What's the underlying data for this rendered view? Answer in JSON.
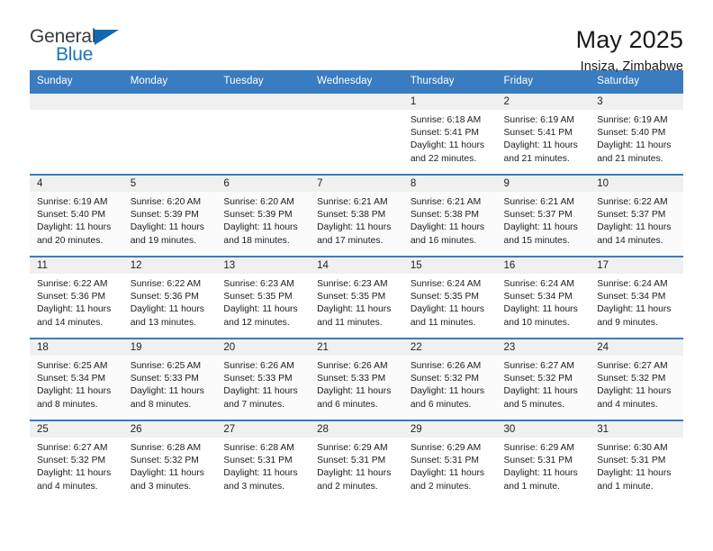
{
  "brand": {
    "name_top": "General",
    "name_bottom": "Blue",
    "accent_color": "#1b75bb",
    "triangle_color": "#1268b3"
  },
  "header": {
    "title": "May 2025",
    "location": "Insiza, Zimbabwe"
  },
  "calendar": {
    "header_background": "#3a7cc0",
    "header_text_color": "#ffffff",
    "daynum_background": "#f0f0f0",
    "weekday_headers": [
      "Sunday",
      "Monday",
      "Tuesday",
      "Wednesday",
      "Thursday",
      "Friday",
      "Saturday"
    ],
    "weeks": [
      [
        {
          "day": "",
          "sunrise": "",
          "sunset": "",
          "daylight_line1": "",
          "daylight_line2": ""
        },
        {
          "day": "",
          "sunrise": "",
          "sunset": "",
          "daylight_line1": "",
          "daylight_line2": ""
        },
        {
          "day": "",
          "sunrise": "",
          "sunset": "",
          "daylight_line1": "",
          "daylight_line2": ""
        },
        {
          "day": "",
          "sunrise": "",
          "sunset": "",
          "daylight_line1": "",
          "daylight_line2": ""
        },
        {
          "day": "1",
          "sunrise": "Sunrise: 6:18 AM",
          "sunset": "Sunset: 5:41 PM",
          "daylight_line1": "Daylight: 11 hours",
          "daylight_line2": "and 22 minutes."
        },
        {
          "day": "2",
          "sunrise": "Sunrise: 6:19 AM",
          "sunset": "Sunset: 5:41 PM",
          "daylight_line1": "Daylight: 11 hours",
          "daylight_line2": "and 21 minutes."
        },
        {
          "day": "3",
          "sunrise": "Sunrise: 6:19 AM",
          "sunset": "Sunset: 5:40 PM",
          "daylight_line1": "Daylight: 11 hours",
          "daylight_line2": "and 21 minutes."
        }
      ],
      [
        {
          "day": "4",
          "sunrise": "Sunrise: 6:19 AM",
          "sunset": "Sunset: 5:40 PM",
          "daylight_line1": "Daylight: 11 hours",
          "daylight_line2": "and 20 minutes."
        },
        {
          "day": "5",
          "sunrise": "Sunrise: 6:20 AM",
          "sunset": "Sunset: 5:39 PM",
          "daylight_line1": "Daylight: 11 hours",
          "daylight_line2": "and 19 minutes."
        },
        {
          "day": "6",
          "sunrise": "Sunrise: 6:20 AM",
          "sunset": "Sunset: 5:39 PM",
          "daylight_line1": "Daylight: 11 hours",
          "daylight_line2": "and 18 minutes."
        },
        {
          "day": "7",
          "sunrise": "Sunrise: 6:21 AM",
          "sunset": "Sunset: 5:38 PM",
          "daylight_line1": "Daylight: 11 hours",
          "daylight_line2": "and 17 minutes."
        },
        {
          "day": "8",
          "sunrise": "Sunrise: 6:21 AM",
          "sunset": "Sunset: 5:38 PM",
          "daylight_line1": "Daylight: 11 hours",
          "daylight_line2": "and 16 minutes."
        },
        {
          "day": "9",
          "sunrise": "Sunrise: 6:21 AM",
          "sunset": "Sunset: 5:37 PM",
          "daylight_line1": "Daylight: 11 hours",
          "daylight_line2": "and 15 minutes."
        },
        {
          "day": "10",
          "sunrise": "Sunrise: 6:22 AM",
          "sunset": "Sunset: 5:37 PM",
          "daylight_line1": "Daylight: 11 hours",
          "daylight_line2": "and 14 minutes."
        }
      ],
      [
        {
          "day": "11",
          "sunrise": "Sunrise: 6:22 AM",
          "sunset": "Sunset: 5:36 PM",
          "daylight_line1": "Daylight: 11 hours",
          "daylight_line2": "and 14 minutes."
        },
        {
          "day": "12",
          "sunrise": "Sunrise: 6:22 AM",
          "sunset": "Sunset: 5:36 PM",
          "daylight_line1": "Daylight: 11 hours",
          "daylight_line2": "and 13 minutes."
        },
        {
          "day": "13",
          "sunrise": "Sunrise: 6:23 AM",
          "sunset": "Sunset: 5:35 PM",
          "daylight_line1": "Daylight: 11 hours",
          "daylight_line2": "and 12 minutes."
        },
        {
          "day": "14",
          "sunrise": "Sunrise: 6:23 AM",
          "sunset": "Sunset: 5:35 PM",
          "daylight_line1": "Daylight: 11 hours",
          "daylight_line2": "and 11 minutes."
        },
        {
          "day": "15",
          "sunrise": "Sunrise: 6:24 AM",
          "sunset": "Sunset: 5:35 PM",
          "daylight_line1": "Daylight: 11 hours",
          "daylight_line2": "and 11 minutes."
        },
        {
          "day": "16",
          "sunrise": "Sunrise: 6:24 AM",
          "sunset": "Sunset: 5:34 PM",
          "daylight_line1": "Daylight: 11 hours",
          "daylight_line2": "and 10 minutes."
        },
        {
          "day": "17",
          "sunrise": "Sunrise: 6:24 AM",
          "sunset": "Sunset: 5:34 PM",
          "daylight_line1": "Daylight: 11 hours",
          "daylight_line2": "and 9 minutes."
        }
      ],
      [
        {
          "day": "18",
          "sunrise": "Sunrise: 6:25 AM",
          "sunset": "Sunset: 5:34 PM",
          "daylight_line1": "Daylight: 11 hours",
          "daylight_line2": "and 8 minutes."
        },
        {
          "day": "19",
          "sunrise": "Sunrise: 6:25 AM",
          "sunset": "Sunset: 5:33 PM",
          "daylight_line1": "Daylight: 11 hours",
          "daylight_line2": "and 8 minutes."
        },
        {
          "day": "20",
          "sunrise": "Sunrise: 6:26 AM",
          "sunset": "Sunset: 5:33 PM",
          "daylight_line1": "Daylight: 11 hours",
          "daylight_line2": "and 7 minutes."
        },
        {
          "day": "21",
          "sunrise": "Sunrise: 6:26 AM",
          "sunset": "Sunset: 5:33 PM",
          "daylight_line1": "Daylight: 11 hours",
          "daylight_line2": "and 6 minutes."
        },
        {
          "day": "22",
          "sunrise": "Sunrise: 6:26 AM",
          "sunset": "Sunset: 5:32 PM",
          "daylight_line1": "Daylight: 11 hours",
          "daylight_line2": "and 6 minutes."
        },
        {
          "day": "23",
          "sunrise": "Sunrise: 6:27 AM",
          "sunset": "Sunset: 5:32 PM",
          "daylight_line1": "Daylight: 11 hours",
          "daylight_line2": "and 5 minutes."
        },
        {
          "day": "24",
          "sunrise": "Sunrise: 6:27 AM",
          "sunset": "Sunset: 5:32 PM",
          "daylight_line1": "Daylight: 11 hours",
          "daylight_line2": "and 4 minutes."
        }
      ],
      [
        {
          "day": "25",
          "sunrise": "Sunrise: 6:27 AM",
          "sunset": "Sunset: 5:32 PM",
          "daylight_line1": "Daylight: 11 hours",
          "daylight_line2": "and 4 minutes."
        },
        {
          "day": "26",
          "sunrise": "Sunrise: 6:28 AM",
          "sunset": "Sunset: 5:32 PM",
          "daylight_line1": "Daylight: 11 hours",
          "daylight_line2": "and 3 minutes."
        },
        {
          "day": "27",
          "sunrise": "Sunrise: 6:28 AM",
          "sunset": "Sunset: 5:31 PM",
          "daylight_line1": "Daylight: 11 hours",
          "daylight_line2": "and 3 minutes."
        },
        {
          "day": "28",
          "sunrise": "Sunrise: 6:29 AM",
          "sunset": "Sunset: 5:31 PM",
          "daylight_line1": "Daylight: 11 hours",
          "daylight_line2": "and 2 minutes."
        },
        {
          "day": "29",
          "sunrise": "Sunrise: 6:29 AM",
          "sunset": "Sunset: 5:31 PM",
          "daylight_line1": "Daylight: 11 hours",
          "daylight_line2": "and 2 minutes."
        },
        {
          "day": "30",
          "sunrise": "Sunrise: 6:29 AM",
          "sunset": "Sunset: 5:31 PM",
          "daylight_line1": "Daylight: 11 hours",
          "daylight_line2": "and 1 minute."
        },
        {
          "day": "31",
          "sunrise": "Sunrise: 6:30 AM",
          "sunset": "Sunset: 5:31 PM",
          "daylight_line1": "Daylight: 11 hours",
          "daylight_line2": "and 1 minute."
        }
      ]
    ]
  }
}
